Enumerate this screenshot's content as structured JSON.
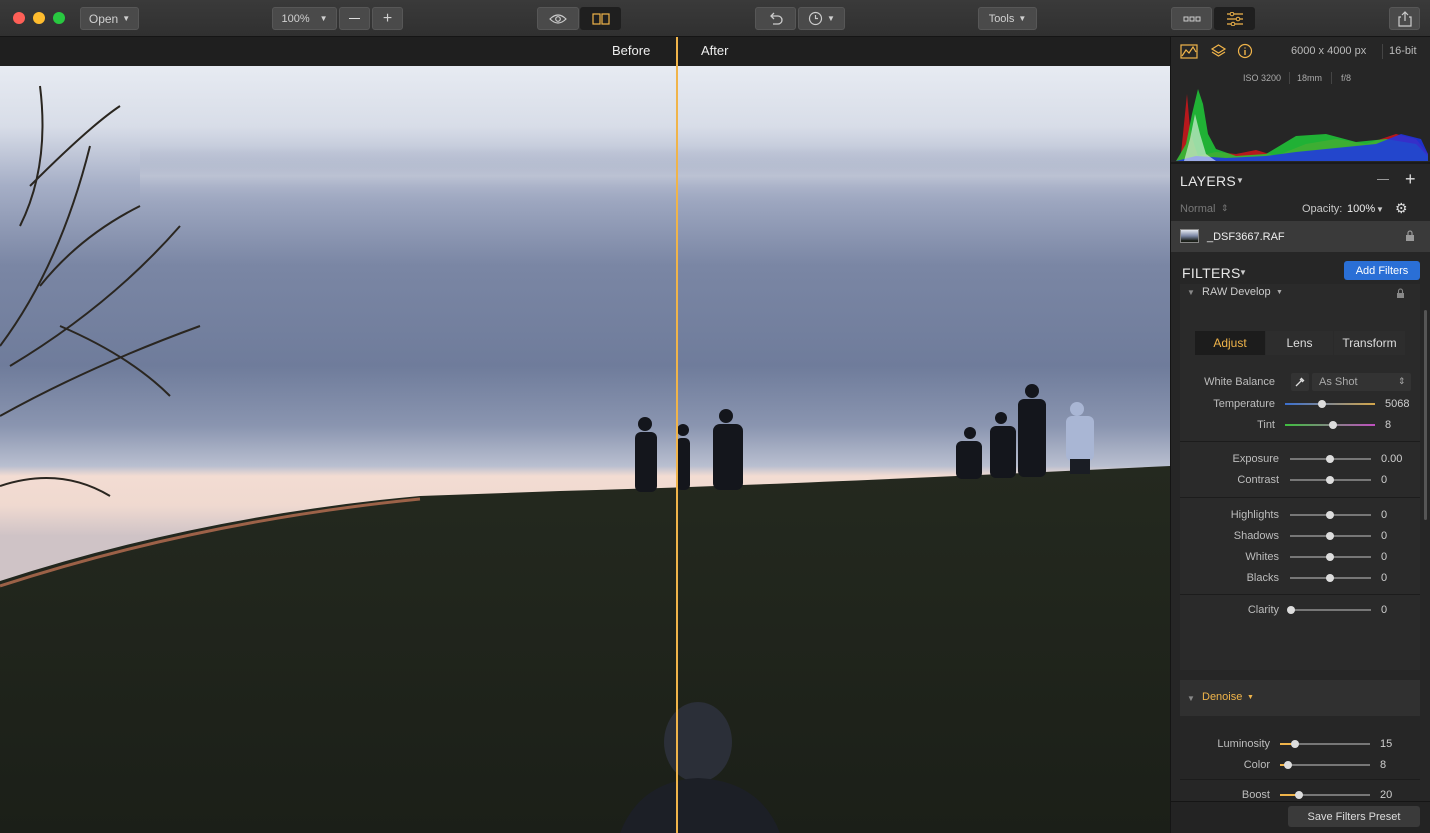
{
  "toolbar": {
    "open_label": "Open",
    "zoom_value": "100%",
    "tools_label": "Tools"
  },
  "compare": {
    "before_label": "Before",
    "after_label": "After"
  },
  "info": {
    "dimensions": "6000 x 4000 px",
    "bit_depth": "16-bit",
    "iso": "ISO 3200",
    "focal_length": "18mm",
    "aperture": "f/8"
  },
  "layers": {
    "title": "LAYERS",
    "blend_mode": "Normal",
    "opacity_label": "Opacity:",
    "opacity_value": "100%",
    "layer_name": "_DSF3667.RAF"
  },
  "filters": {
    "title": "FILTERS",
    "add_label": "Add Filters",
    "raw_title": "RAW Develop",
    "tabs": [
      "Adjust",
      "Lens",
      "Transform"
    ],
    "wb_label": "White Balance",
    "wb_value": "As Shot",
    "sliders": [
      {
        "label": "Temperature",
        "value": "5068"
      },
      {
        "label": "Tint",
        "value": "8"
      },
      {
        "label": "Exposure",
        "value": "0.00"
      },
      {
        "label": "Contrast",
        "value": "0"
      },
      {
        "label": "Highlights",
        "value": "0"
      },
      {
        "label": "Shadows",
        "value": "0"
      },
      {
        "label": "Whites",
        "value": "0"
      },
      {
        "label": "Blacks",
        "value": "0"
      },
      {
        "label": "Clarity",
        "value": "0"
      }
    ],
    "denoise_title": "Denoise",
    "denoise": [
      {
        "label": "Luminosity",
        "value": "15"
      },
      {
        "label": "Color",
        "value": "8"
      },
      {
        "label": "Boost",
        "value": "20"
      }
    ],
    "save_preset_label": "Save Filters Preset"
  },
  "colors": {
    "accent": "#f0b44a",
    "blue_button": "#2a6fd6",
    "active_tab_text": "#f0b44a"
  }
}
